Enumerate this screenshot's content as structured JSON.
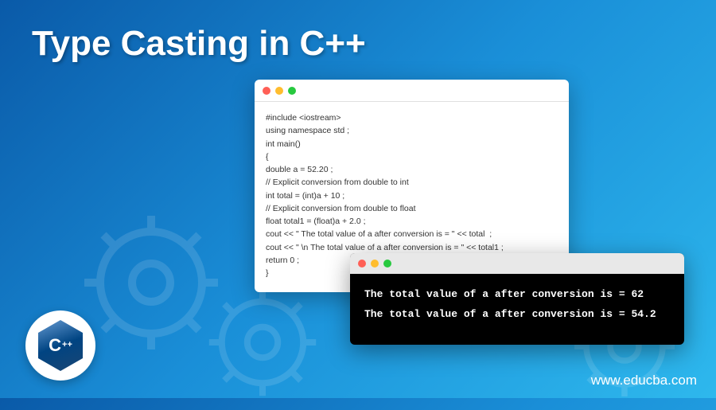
{
  "title": "Type Casting in C++",
  "code": {
    "lines": [
      "#include <iostream>",
      "using namespace std ;",
      "int main()",
      "{",
      "double a = 52.20 ;",
      "// Explicit conversion from double to int",
      "int total = (int)a + 10 ;",
      "// Explicit conversion from double to float",
      "float total1 = (float)a + 2.0 ;",
      "cout << \" The total value of a after conversion is = \" << total  ;",
      "cout << \" \\n The total value of a after conversion is = \" << total1 ;",
      "return 0 ;",
      "}"
    ]
  },
  "terminal": {
    "lines": [
      "The total value of a after conversion is = 62",
      "The total value of a after conversion is = 54.2"
    ]
  },
  "logo": {
    "text": "C",
    "plus": "++"
  },
  "website": "www.educba.com"
}
